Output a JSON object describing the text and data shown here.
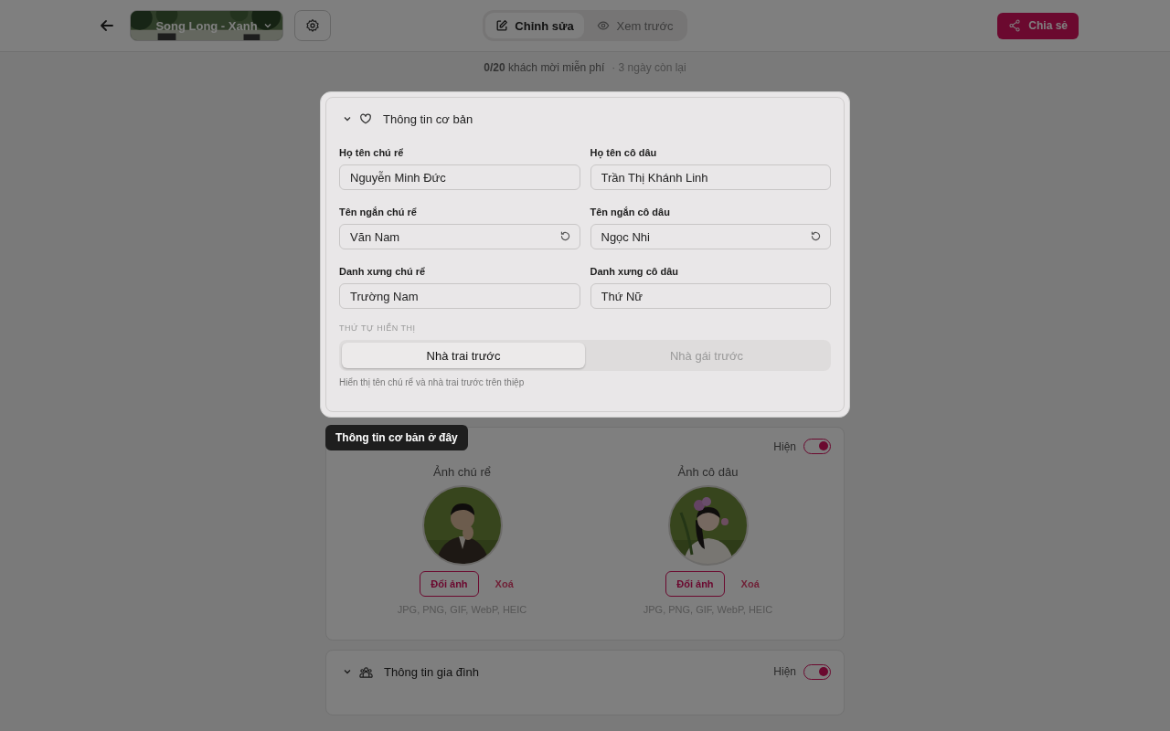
{
  "header": {
    "template": {
      "name": "Song Long - Xanh"
    },
    "tabs": [
      {
        "label": "Chỉnh sửa",
        "selected": true
      },
      {
        "label": "Xem trước",
        "selected": false
      }
    ],
    "share": {
      "label": "Chia sẻ"
    }
  },
  "quota": {
    "text": "**0/20** khách mời miễn phí",
    "remaining": "· 3 ngày còn lại"
  },
  "basic_section": {
    "title": "Thông tin cơ bản",
    "expanded": true,
    "fields": [
      {
        "label": "Họ tên chú rể",
        "value": "Nguyễn Minh Đức",
        "resettable": false
      },
      {
        "label": "Họ tên cô dâu",
        "value": "Trần Thị Khánh Linh",
        "resettable": false
      },
      {
        "label": "Tên ngắn chú rể",
        "value": "Văn Nam",
        "resettable": true
      },
      {
        "label": "Tên ngắn cô dâu",
        "value": "Ngọc Nhi",
        "resettable": true
      },
      {
        "label": "Danh xưng chú rể",
        "value": "Trường Nam",
        "resettable": false
      },
      {
        "label": "Danh xưng cô dâu",
        "value": "Thứ Nữ",
        "resettable": false
      }
    ],
    "order": {
      "label": "THỨ TỰ HIỂN THỊ",
      "options": [
        {
          "label": "Nhà trai trước",
          "selected": true
        },
        {
          "label": "Nhà gái trước",
          "selected": false
        }
      ],
      "hint": "Hiển thị tên chú rể và nhà trai trước trên thiệp"
    }
  },
  "tooltip": {
    "text": "Thông tin cơ bản ở đây"
  },
  "photos_section": {
    "visible_label": "Hiện",
    "on": true,
    "photos": [
      {
        "label": "Ảnh chú rể",
        "change": "Đổi ảnh",
        "remove": "Xoá",
        "formats": "JPG, PNG, GIF, WebP, HEIC"
      },
      {
        "label": "Ảnh cô dâu",
        "change": "Đổi ảnh",
        "remove": "Xoá",
        "formats": "JPG, PNG, GIF, WebP, HEIC"
      }
    ]
  },
  "family_section": {
    "title": "Thông tin gia đình",
    "expanded": true,
    "visible_label": "Hiện",
    "on": true
  }
}
